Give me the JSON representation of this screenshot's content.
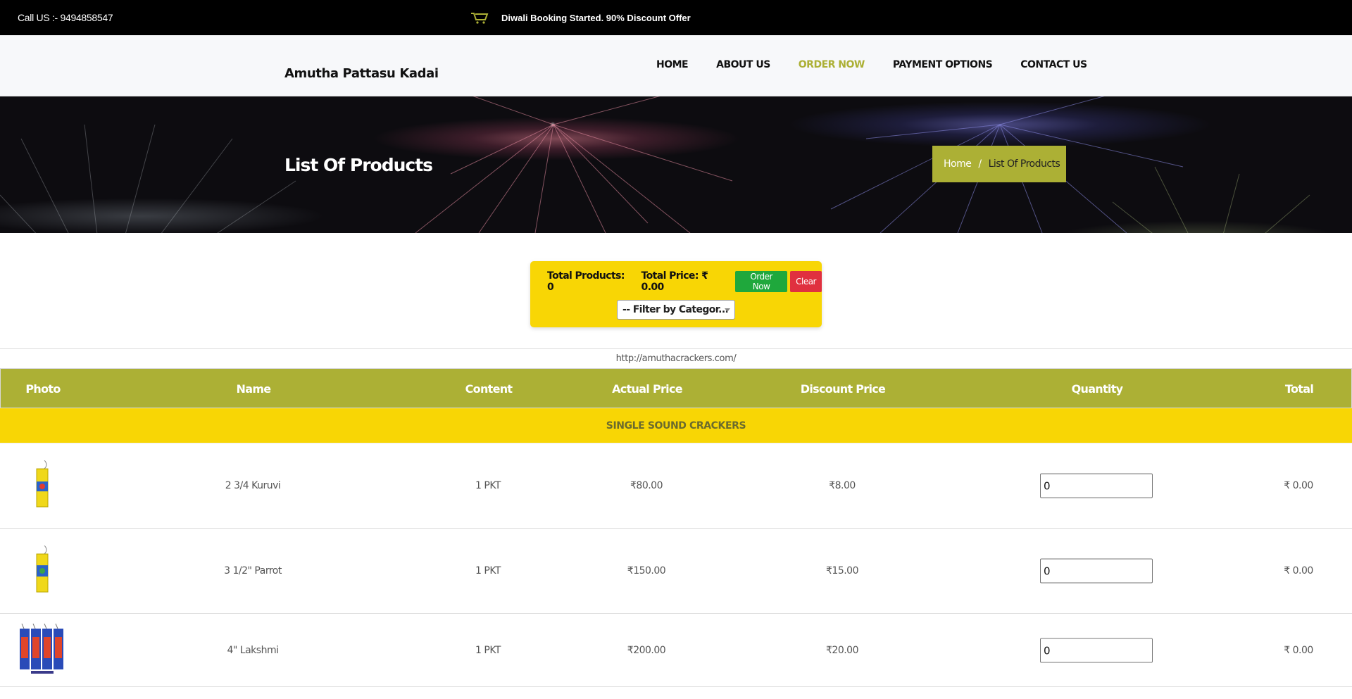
{
  "topbar": {
    "call": "Call US :- 9494858547",
    "promo": "Diwali Booking Started. 90% Discount Offer",
    "promo_icon": "cart-icon"
  },
  "header": {
    "brand": "Amutha Pattasu Kadai",
    "nav": [
      {
        "label": "HOME",
        "active": false
      },
      {
        "label": "ABOUT US",
        "active": false
      },
      {
        "label": "ORDER NOW",
        "active": true
      },
      {
        "label": "PAYMENT OPTIONS",
        "active": false
      },
      {
        "label": "CONTACT US",
        "active": false
      }
    ]
  },
  "hero": {
    "title": "List Of Products",
    "breadcrumb_home": "Home",
    "breadcrumb_sep": "/",
    "breadcrumb_current": "List Of Products"
  },
  "summary": {
    "total_products": "Total Products: 0",
    "total_price": "Total Price: ₹ 0.00",
    "order_button": "Order Now",
    "clear_button": "Clear",
    "filter_value": "-- Filter by Categor..."
  },
  "site_url": "http://amuthacrackers.com/",
  "table": {
    "headers": [
      "Photo",
      "Name",
      "Content",
      "Actual Price",
      "Discount Price",
      "Quantity",
      "Total"
    ],
    "category": "SINGLE SOUND CRACKERS",
    "rows": [
      {
        "name": "2 3/4 Kuruvi",
        "content": "1 PKT",
        "actual": "₹80.00",
        "discount": "₹8.00",
        "qty": "0",
        "total": "₹ 0.00"
      },
      {
        "name": "3 1/2\" Parrot",
        "content": "1 PKT",
        "actual": "₹150.00",
        "discount": "₹15.00",
        "qty": "0",
        "total": "₹ 0.00"
      },
      {
        "name": "4\" Lakshmi",
        "content": "1 PKT",
        "actual": "₹200.00",
        "discount": "₹20.00",
        "qty": "0",
        "total": "₹ 0.00"
      }
    ]
  },
  "colors": {
    "accent": "#acb035",
    "yellow": "#f8d605",
    "green": "#1fa83c",
    "red": "#e0303f"
  }
}
